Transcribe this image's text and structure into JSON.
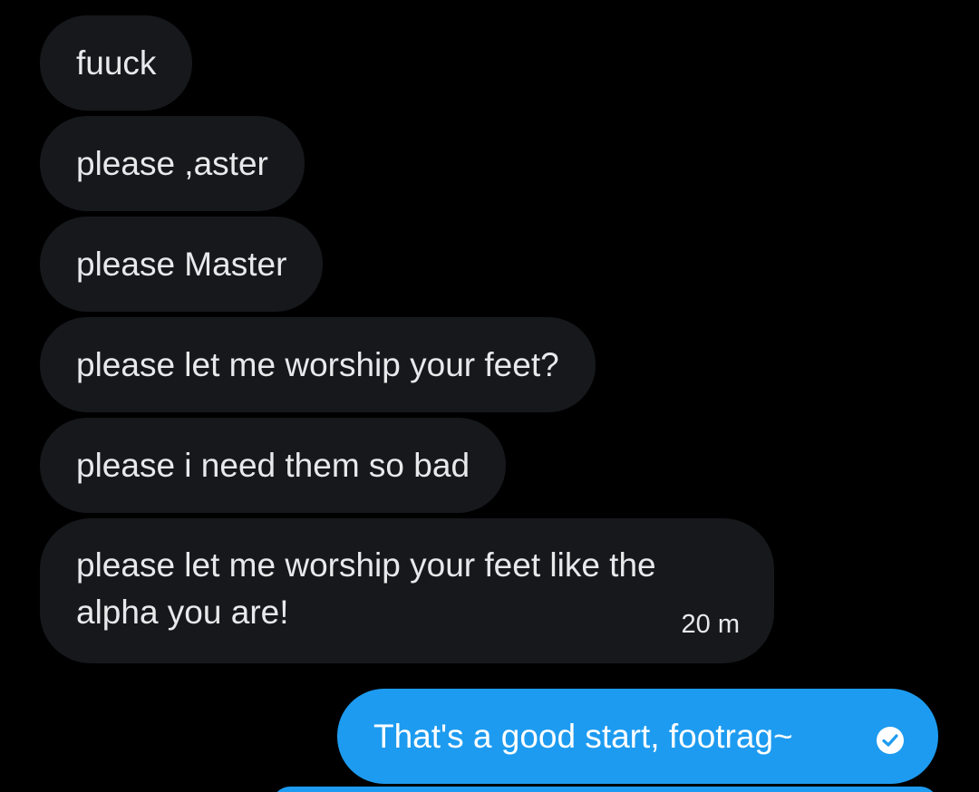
{
  "messages": {
    "received": [
      {
        "text": "fuuck"
      },
      {
        "text": "please ,aster"
      },
      {
        "text": "please Master"
      },
      {
        "text": "please let me worship your feet?"
      },
      {
        "text": "please i need them so bad"
      },
      {
        "text": "please let me worship your feet like the alpha you are!",
        "time": "20 m"
      }
    ],
    "sent": [
      {
        "text": "That's a good start, footrag~",
        "status_icon": "check-circle-icon"
      }
    ]
  },
  "colors": {
    "background": "#000000",
    "received_bubble": "#16181c",
    "sent_bubble": "#1d9bf0",
    "text": "#e7e9ea"
  }
}
